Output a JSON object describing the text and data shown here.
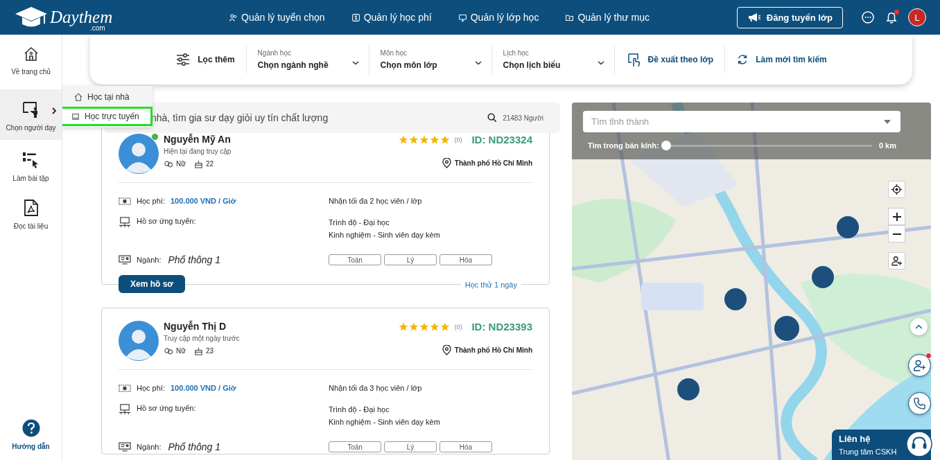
{
  "header": {
    "logo": "Daythem",
    "logo_suffix": ".com",
    "nav": [
      {
        "kind": "users",
        "label": "Quản lý tuyển chọn"
      },
      {
        "kind": "fee",
        "label": "Quản lý học phí"
      },
      {
        "kind": "class",
        "label": "Quản lý lớp học"
      },
      {
        "kind": "folder",
        "label": "Quản lý thư mục"
      }
    ],
    "post_button": "Đăng tuyển lớp",
    "notification": true,
    "avatar_initial": "L"
  },
  "sidebar": {
    "items": [
      {
        "kind": "home",
        "label": "Về trang chủ",
        "selected": false
      },
      {
        "kind": "teacher",
        "label": "Chọn người dạy",
        "selected": true
      },
      {
        "kind": "exercise",
        "label": "Làm bài tập",
        "selected": false
      },
      {
        "kind": "document",
        "label": "Đọc tài liệu",
        "selected": false
      }
    ],
    "help": "Hướng dẫn"
  },
  "submenu": [
    {
      "kind": "home",
      "label": "Học tại nhà",
      "selected": false
    },
    {
      "kind": "online",
      "label": "Học trực tuyến",
      "selected": true
    }
  ],
  "filters": {
    "more": "Lọc thêm",
    "selects": [
      {
        "label": "Ngành học",
        "value": "Chọn ngành nghề"
      },
      {
        "label": "Môn học",
        "value": "Chọn môn lớp"
      },
      {
        "label": "Lịch học",
        "value": "Chọn lịch biểu"
      }
    ],
    "suggest": "Đề xuất theo lớp",
    "reset": "Làm mới tìm kiếm"
  },
  "search": {
    "placeholder": "nhà, tìm gia sư dạy giỏi uy tín chất lượng",
    "count": "21483 Người"
  },
  "tutors": [
    {
      "name": "Nguyễn Mỹ An",
      "online": true,
      "status": "Hiện tại đang truy cập",
      "gender": "Nữ",
      "age": "22",
      "stars": 5,
      "reviews": "(0)",
      "id": "ID: ND23324",
      "location": "Thành phố Hồ Chí Minh",
      "fee_label": "Học phí:",
      "fee": "100.000 VND / Giờ",
      "capacity": "Nhận tối đa 2 học viên / lớp",
      "profile_label": "Hồ sơ ứng tuyển:",
      "degree": "Trình độ - Đại học",
      "experience": "Kinh nghiệm - Sinh viên dạy kèm",
      "major_label": "Ngành:",
      "major": "Phổ thông 1",
      "subjects": [
        "Toán",
        "Lý",
        "Hóa"
      ],
      "button": "Xem hồ sơ",
      "trial": "Học thử 1 ngày"
    },
    {
      "name": "Nguyễn Thị D",
      "online": false,
      "status": "Truy cập một ngày trước",
      "gender": "Nữ",
      "age": "23",
      "stars": 5,
      "reviews": "(0)",
      "id": "ID: ND23393",
      "location": "Thành phố Hồ Chí Minh",
      "fee_label": "Học phí:",
      "fee": "100.000 VND / Giờ",
      "capacity": "Nhận tối đa 3 học viên / lớp",
      "profile_label": "Hồ sơ ứng tuyển:",
      "degree": "Trình độ - Đại học",
      "experience": "Kinh nghiệm - Sinh viên dạy kèm",
      "major_label": "Ngành:",
      "major": "Phổ thông 1",
      "subjects": [
        "Toán",
        "Lý",
        "Hóa"
      ]
    }
  ],
  "map": {
    "kind": "picture",
    "search_placeholder": "Tìm tỉnh thành",
    "radius": {
      "label": "Tìm trong bán kính:",
      "level": 0,
      "reading": "0 km"
    }
  },
  "contact": {
    "add_badge": true,
    "title": "Liên hệ",
    "subtitle": "Trung tâm CSKH"
  }
}
